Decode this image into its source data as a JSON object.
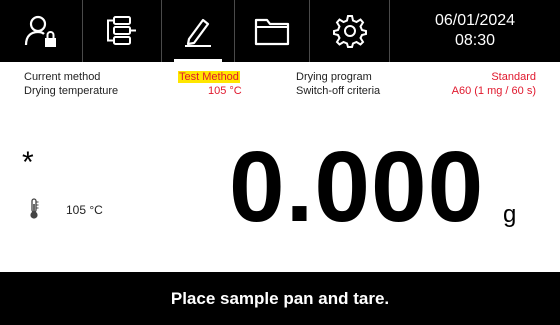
{
  "toolbar": {
    "buttons": [
      {
        "icon": "user-lock-icon"
      },
      {
        "icon": "method-list-icon"
      },
      {
        "icon": "pencil-edit-icon"
      },
      {
        "icon": "folder-icon"
      },
      {
        "icon": "gear-icon"
      }
    ],
    "date": "06/01/2024",
    "time": "08:30"
  },
  "info": {
    "current_method_label": "Current method",
    "current_method_value": "Test Method",
    "drying_temperature_label": "Drying temperature",
    "drying_temperature_value": "105 °C",
    "drying_program_label": "Drying program",
    "drying_program_value": "Standard",
    "switch_off_label": "Switch-off criteria",
    "switch_off_value": "A60 (1 mg / 60 s)"
  },
  "display": {
    "stability_symbol": "*",
    "temperature": "105 °C",
    "weight": "0.000",
    "unit": "g"
  },
  "status": {
    "message": "Place sample pan and tare."
  },
  "colors": {
    "accent_red": "#e0182d",
    "highlight_yellow": "#ffe600",
    "bar_black": "#000000"
  }
}
